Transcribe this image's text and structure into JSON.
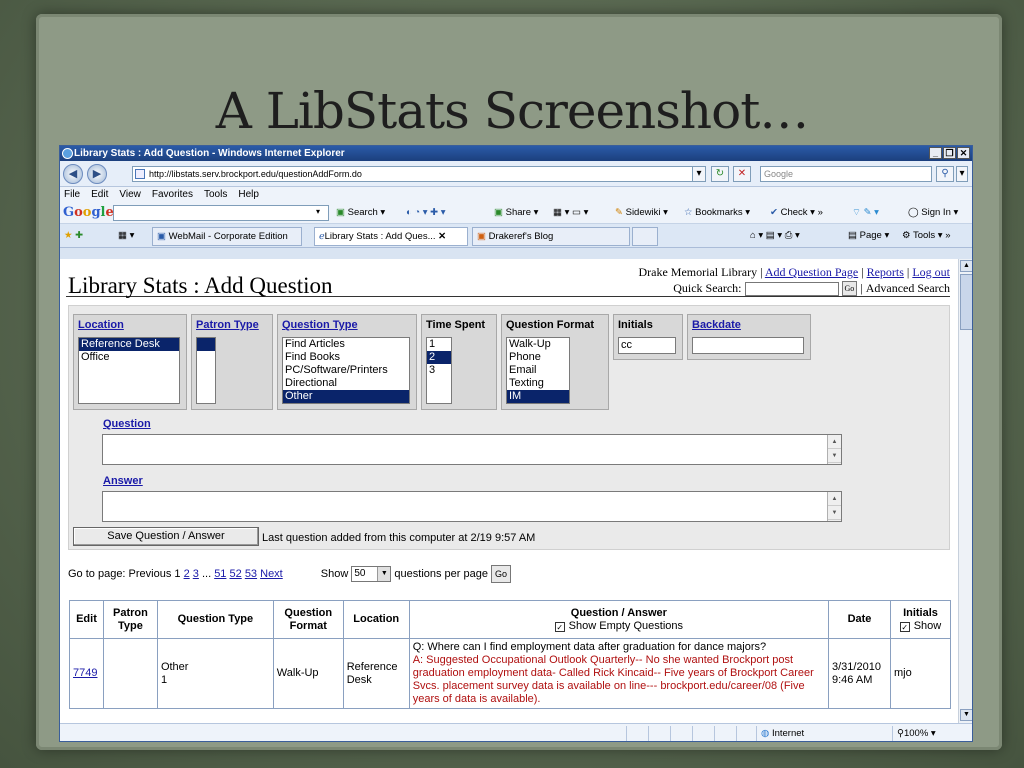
{
  "slide": {
    "title": "A LibStats Screenshot…"
  },
  "browser": {
    "window_title": "Library Stats : Add Question - Windows Internet Explorer",
    "url": "http://libstats.serv.brockport.edu/questionAddForm.do",
    "search_placeholder": "Google",
    "menu": [
      "File",
      "Edit",
      "View",
      "Favorites",
      "Tools",
      "Help"
    ],
    "google_logo": "Google",
    "google_search": "Search",
    "google_share": "Share",
    "google_sidewiki": "Sidewiki",
    "google_bookmarks": "Bookmarks",
    "google_check": "Check",
    "google_signin": "Sign In",
    "tabs": [
      "WebMail - Corporate Edition",
      "Library Stats : Add Ques...",
      "Drakeref's Blog"
    ],
    "page_menu": "Page",
    "tools_menu": "Tools",
    "status_zone": "Internet",
    "zoom": "100%"
  },
  "page": {
    "title": "Library Stats : Add Question",
    "library": "Drake Memorial Library",
    "sep": "|",
    "link_add": "Add Question Page",
    "link_reports": "Reports",
    "link_logout": "Log out",
    "quick_search_label": "Quick Search:",
    "go": "Go",
    "advanced_search": "Advanced Search"
  },
  "form": {
    "location": {
      "label": "Location",
      "options": [
        "Reference Desk",
        "Office"
      ]
    },
    "patron_type": {
      "label": "Patron Type"
    },
    "question_type": {
      "label": "Question Type",
      "options": [
        "Find Articles",
        "Find Books",
        "PC/Software/Printers",
        "Directional",
        "Other"
      ]
    },
    "time_spent": {
      "label": "Time Spent",
      "options": [
        "1",
        "2",
        "3"
      ]
    },
    "question_format": {
      "label": "Question Format",
      "options": [
        "Walk-Up",
        "Phone",
        "Email",
        "Texting",
        "IM"
      ]
    },
    "initials": {
      "label": "Initials",
      "value": "cc"
    },
    "backdate": {
      "label": "Backdate",
      "value": ""
    },
    "question_label": "Question",
    "answer_label": "Answer",
    "save_button": "Save Question / Answer",
    "last_question": "Last question added from this computer at 2/19 9:57 AM"
  },
  "paging": {
    "goto": "Go to page: Previous 1",
    "p2": "2",
    "p3": "3",
    "ellipsis": "...",
    "p51": "51",
    "p52": "52",
    "p53": "53",
    "next": "Next",
    "show": "Show",
    "per_page": "50",
    "per_page_label": "questions per page",
    "go": "Go"
  },
  "table": {
    "headers": {
      "edit": "Edit",
      "patron_type": "Patron Type",
      "question_type": "Question Type",
      "question_format": "Question Format",
      "location": "Location",
      "qa": "Question / Answer",
      "show_empty": "Show Empty Questions",
      "date": "Date",
      "initials": "Initials",
      "show": "Show"
    },
    "rows": [
      {
        "id": "7749",
        "patron_type": "",
        "question_type": "Other",
        "time": "1",
        "format": "Walk-Up",
        "location": "Reference Desk",
        "question": "Q: Where can I find employment data after graduation for dance majors?",
        "answer": "A: Suggested Occupational Outlook Quarterly-- No she wanted Brockport post graduation employment data- Called Rick Kincaid-- Five years of Brockport Career Svcs. placement survey data is available on line--- brockport.edu/career/08 (Five years of data is available).",
        "date": "3/31/2010 9:46 AM",
        "initials": "mjo"
      }
    ]
  },
  "colors": {
    "titlebar": "#1c3f7d",
    "link": "#1a1aa8",
    "selection": "#0a246a",
    "answer": "#b01010"
  }
}
